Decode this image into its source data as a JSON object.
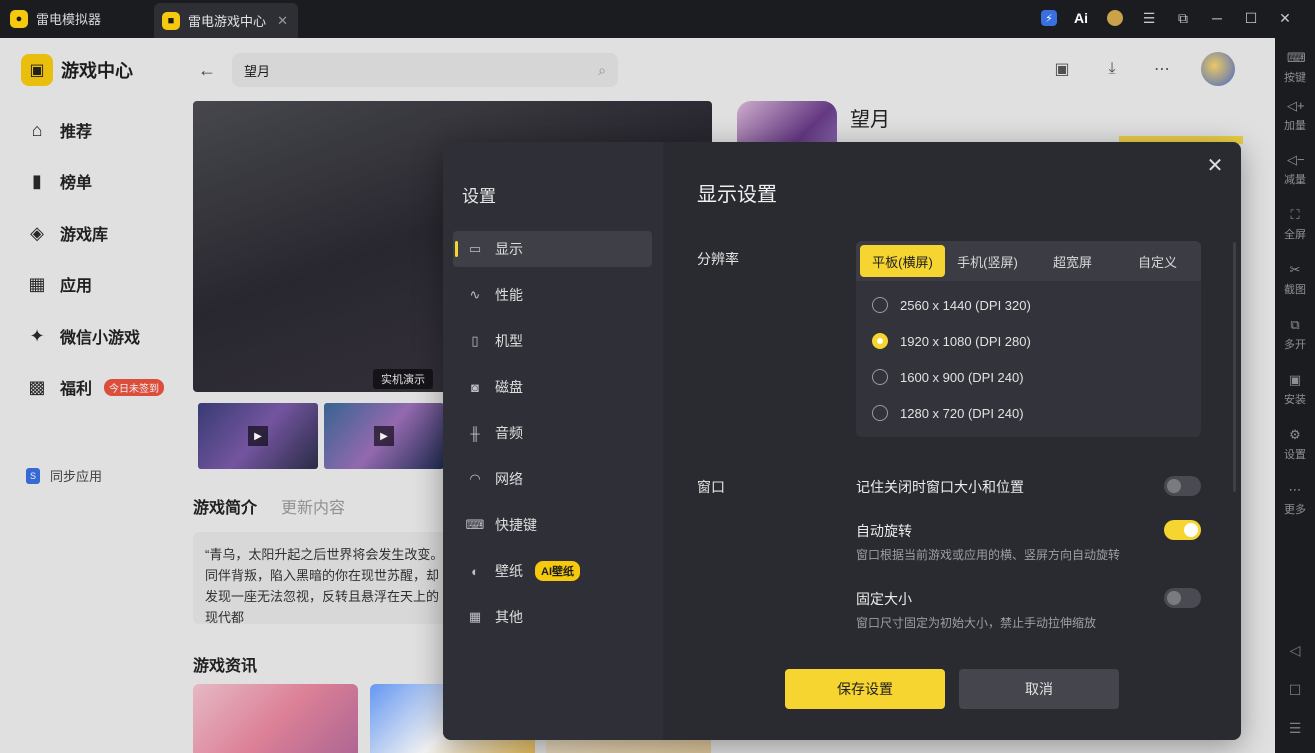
{
  "titlebar": {
    "app_name": "雷电模拟器",
    "tab_label": "雷电游戏中心",
    "tab_close": "✕",
    "buttons": [
      "bolt-icon",
      "ai-icon",
      "coin-icon",
      "menu-icon",
      "screen-icon",
      "minimize-icon",
      "maximize-icon",
      "close-icon"
    ]
  },
  "right_toolbar": {
    "items": [
      {
        "label": "按键",
        "icon": "keyboard-icon"
      },
      {
        "label": "加量",
        "icon": "volume-up-icon"
      },
      {
        "label": "减量",
        "icon": "volume-down-icon"
      },
      {
        "label": "全屏",
        "icon": "fullscreen-icon"
      },
      {
        "label": "截图",
        "icon": "scissors-icon"
      },
      {
        "label": "多开",
        "icon": "multi-instance-icon"
      },
      {
        "label": "安装",
        "icon": "apk-install-icon"
      },
      {
        "label": "设置",
        "icon": "gear-icon"
      },
      {
        "label": "更多",
        "icon": "more-icon"
      }
    ]
  },
  "sidebar": {
    "brand": "游戏中心",
    "items": [
      {
        "label": "推荐"
      },
      {
        "label": "榜单"
      },
      {
        "label": "游戏库"
      },
      {
        "label": "应用"
      },
      {
        "label": "微信小游戏"
      },
      {
        "label": "福利",
        "badge": "今日未签到"
      }
    ],
    "sync": "同步应用"
  },
  "search": {
    "value": "望月"
  },
  "media": {
    "demo_label": "实机演示"
  },
  "detail": {
    "tabs": [
      "游戏简介",
      "更新内容"
    ],
    "description": "“青乌，太阳升起之后世界将会发生改变。同伴背叛，陷入黑暗的你在现世苏醒，却发现一座无法忽视，反转且悬浮在天上的现代都",
    "news_title": "游戏资讯",
    "game_name": "望月"
  },
  "settings": {
    "title": "设置",
    "nav": [
      {
        "label": "显示",
        "icon": "monitor-icon"
      },
      {
        "label": "性能",
        "icon": "performance-icon"
      },
      {
        "label": "机型",
        "icon": "phone-icon"
      },
      {
        "label": "磁盘",
        "icon": "disk-icon"
      },
      {
        "label": "音频",
        "icon": "audio-icon"
      },
      {
        "label": "网络",
        "icon": "wifi-icon"
      },
      {
        "label": "快捷键",
        "icon": "keyboard-icon"
      },
      {
        "label": "壁纸",
        "icon": "palette-icon",
        "badge": "AI壁纸"
      },
      {
        "label": "其他",
        "icon": "grid-icon"
      }
    ],
    "heading": "显示设置",
    "resolution_label": "分辨率",
    "resolution_tabs": [
      "平板(横屏)",
      "手机(竖屏)",
      "超宽屏",
      "自定义"
    ],
    "resolution_options": [
      {
        "label": "2560 x 1440  (DPI 320)",
        "selected": false
      },
      {
        "label": "1920 x 1080  (DPI 280)",
        "selected": true
      },
      {
        "label": "1600 x 900  (DPI 240)",
        "selected": false
      },
      {
        "label": "1280 x 720  (DPI 240)",
        "selected": false
      }
    ],
    "window_label": "窗口",
    "window_options": [
      {
        "title": "记住关闭时窗口大小和位置",
        "desc": "",
        "on": false
      },
      {
        "title": "自动旋转",
        "desc": "窗口根据当前游戏或应用的横、竖屏方向自动旋转",
        "on": true
      },
      {
        "title": "固定大小",
        "desc": "窗口尺寸固定为初始大小，禁止手动拉伸缩放",
        "on": false
      }
    ],
    "save_label": "保存设置",
    "cancel_label": "取消",
    "colors": {
      "accent": "#f6d530",
      "panel": "#2a2b31"
    }
  }
}
